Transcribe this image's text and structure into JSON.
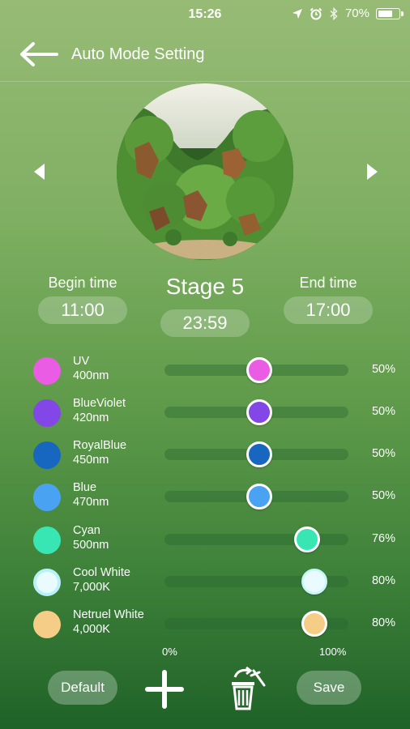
{
  "status_bar": {
    "time": "15:26",
    "battery_text": "70%",
    "battery_level": 0.7,
    "icons": [
      "location-icon",
      "alarm-icon",
      "bluetooth-icon",
      "battery-icon"
    ]
  },
  "header": {
    "title": "Auto Mode Setting",
    "back_icon": "back-arrow-icon"
  },
  "stage": {
    "title": "Stage 5",
    "duration": "23:59",
    "begin_label": "Begin time",
    "begin_value": "11:00",
    "end_label": "End time",
    "end_value": "17:00"
  },
  "channels": [
    {
      "name": "UV",
      "sub": "400nm",
      "color": "#ea5ce4",
      "percent_text": "50%",
      "level": 0.5
    },
    {
      "name": "BlueViolet",
      "sub": "420nm",
      "color": "#8247e6",
      "percent_text": "50%",
      "level": 0.5
    },
    {
      "name": "RoyalBlue",
      "sub": "450nm",
      "color": "#1766bf",
      "percent_text": "50%",
      "level": 0.5
    },
    {
      "name": "Blue",
      "sub": "470nm",
      "color": "#4aa3f2",
      "percent_text": "50%",
      "level": 0.5
    },
    {
      "name": "Cyan",
      "sub": "500nm",
      "color": "#38e6b4",
      "percent_text": "76%",
      "level": 0.76
    },
    {
      "name": "Cool White",
      "sub": "7,000K",
      "color": "#e9fbff",
      "percent_text": "80%",
      "level": 0.8
    },
    {
      "name": "Netruel White",
      "sub": "4,000K",
      "color": "#f6cd86",
      "percent_text": "80%",
      "level": 0.8
    }
  ],
  "scale": {
    "min_label": "0%",
    "max_label": "100%"
  },
  "footer": {
    "default_label": "Default",
    "save_label": "Save",
    "add_icon": "plus-icon",
    "delete_icon": "trash-icon"
  },
  "colors": {
    "pill_bg": "rgba(255,255,255,0.22)",
    "knob_border": "#ffffff"
  }
}
